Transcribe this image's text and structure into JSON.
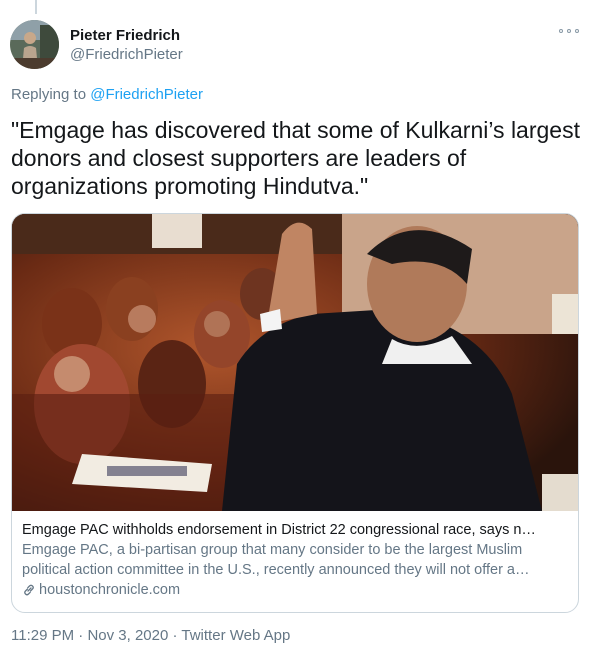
{
  "author": {
    "display_name": "Pieter Friedrich",
    "handle": "@FriedrichPieter",
    "avatar_icon": "avatar-photo"
  },
  "reply": {
    "prefix": "Replying to",
    "handle": "@FriedrichPieter"
  },
  "tweet": {
    "text": "\"Emgage has discovered that some of Kulkarni’s largest donors and closest supporters are leaders of organizations promoting Hindutva.\""
  },
  "card": {
    "image_icon": "news-photo",
    "title": "Emgage PAC withholds endorsement in District 22 congressional race, says n…",
    "description": "Emgage PAC, a bi-partisan group that many consider to be the largest Muslim political action committee in the U.S., recently announced they will not offer a…",
    "domain_icon": "link-icon",
    "domain": "houstonchronicle.com"
  },
  "meta": {
    "time": "11:29 PM",
    "sep1": " · ",
    "date": "Nov 3, 2020",
    "sep2": " · ",
    "source": "Twitter Web App"
  },
  "colors": {
    "link": "#1da1f2",
    "secondary_text": "#657786",
    "border": "#ccd6dd"
  }
}
